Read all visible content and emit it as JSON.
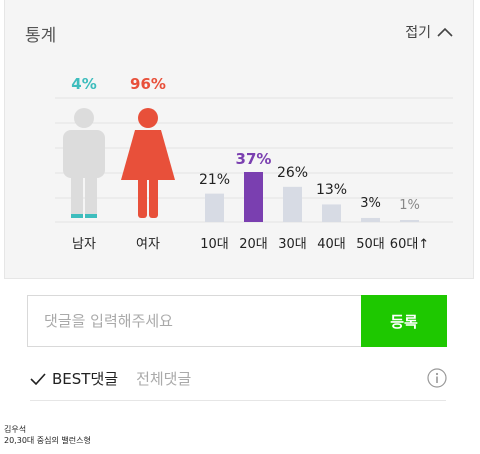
{
  "stats": {
    "title": "통계",
    "collapse_label": "접기"
  },
  "chart_data": [
    {
      "type": "pictogram",
      "categories": [
        "남자",
        "여자"
      ],
      "values": [
        4,
        96
      ],
      "value_labels": [
        "4%",
        "96%"
      ],
      "colors": [
        "#3dbdbd",
        "#e8503a"
      ]
    },
    {
      "type": "bar",
      "categories": [
        "10대",
        "20대",
        "30대",
        "40대",
        "50대",
        "60대↑"
      ],
      "values": [
        21,
        37,
        26,
        13,
        3,
        1
      ],
      "value_labels": [
        "21%",
        "37%",
        "26%",
        "13%",
        "3%",
        "1%"
      ],
      "highlight_index": 1,
      "colors": {
        "bar": "#d7dbe4",
        "highlight": "#7a3fb0"
      }
    }
  ],
  "comment": {
    "placeholder": "댓글을 입력해주세요",
    "submit_label": "등록"
  },
  "tabs": {
    "best_label": "BEST댓글",
    "all_label": "전체댓글"
  },
  "footer": {
    "line1": "김우석",
    "line2": "20,30대 중심의 밸런스형"
  }
}
